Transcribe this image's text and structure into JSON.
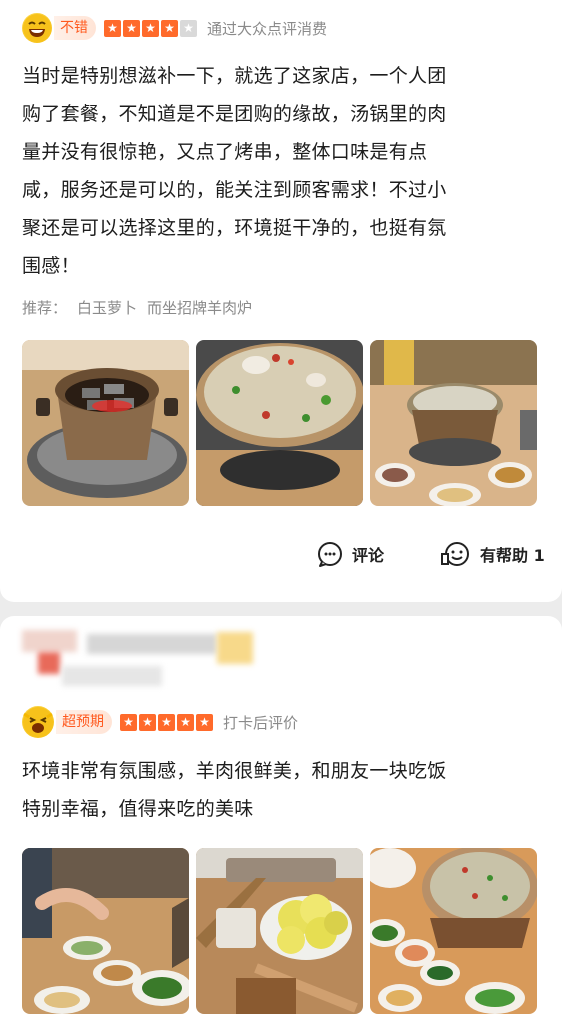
{
  "reviews": [
    {
      "rating_tag": "不错",
      "stars_filled": 4,
      "stars_total": 5,
      "source": "通过大众点评消费",
      "text_lines": [
        "当时是特别想滋补一下，就选了这家店，一个人团",
        "购了套餐，不知道是不是团购的缘故，汤锅里的肉",
        "量并没有很惊艳，又点了烤串，整体口味是有点",
        "咸，服务还是可以的，能关注到顾客需求！不过小",
        "聚还是可以选择这里的，环境挺干净的，也挺有氛",
        "围感！"
      ],
      "recommend_label": "推荐：",
      "recommend_items": [
        "白玉萝卜",
        "而坐招牌羊肉炉"
      ],
      "comment_label": "评论",
      "helpful_label": "有帮助 1"
    },
    {
      "rating_tag": "超预期",
      "stars_filled": 5,
      "stars_total": 5,
      "source": "打卡后评价",
      "text_lines": [
        "环境非常有氛围感，羊肉很鲜美，和朋友一块吃饭",
        "特别幸福，值得来吃的美味"
      ]
    }
  ],
  "colors": {
    "accent": "#ff5a1f",
    "star": "#ff6a2b",
    "muted": "#8a8a8a"
  }
}
